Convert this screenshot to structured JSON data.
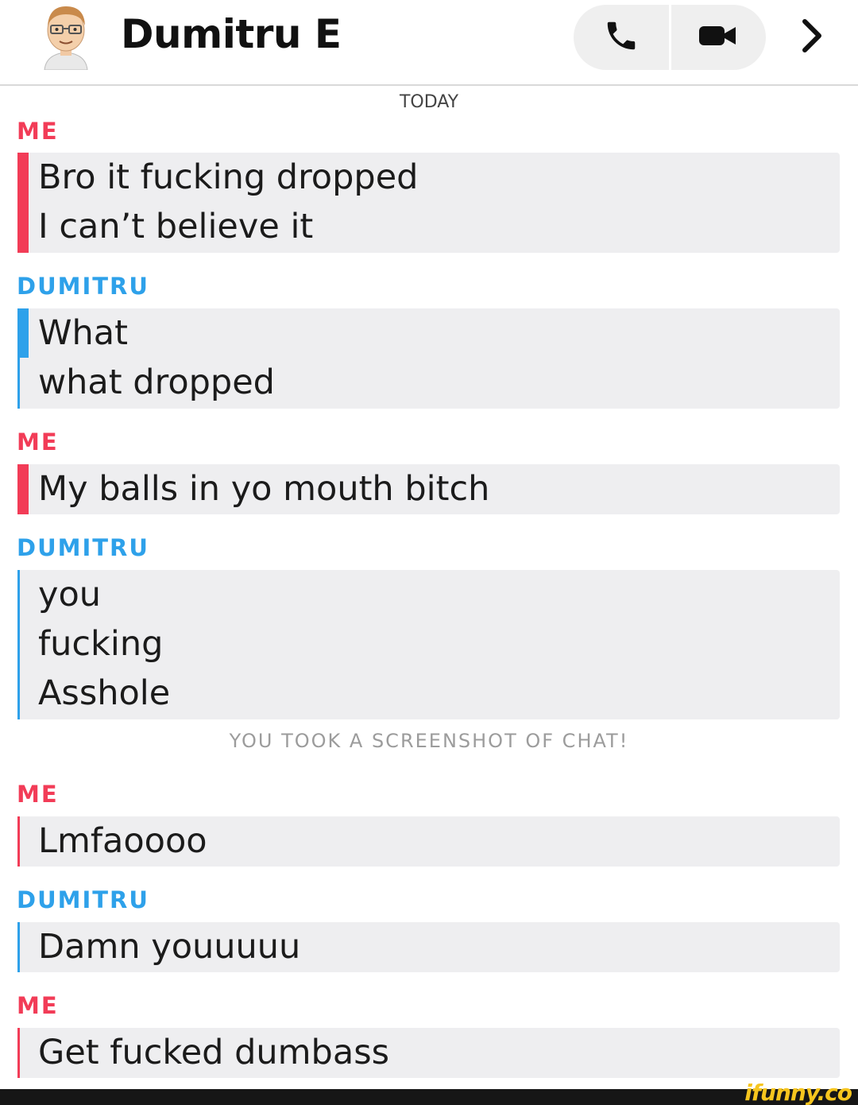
{
  "header": {
    "contact_name": "Dumitru E",
    "icons": {
      "avatar": "bitmoji-avatar-icon",
      "call": "phone-icon",
      "video": "video-camera-icon",
      "more": "chevron-right-icon"
    }
  },
  "chat": {
    "day_label": "TODAY",
    "screenshot_notice": "YOU TOOK A SCREENSHOT OF CHAT!",
    "groups": [
      {
        "sender": "ME",
        "lines": [
          "Bro it fucking dropped",
          "I can’t believe it"
        ]
      },
      {
        "sender": "DUMITRU",
        "lines": [
          "What",
          "what dropped"
        ]
      },
      {
        "sender": "ME",
        "lines": [
          "My balls in yo mouth bitch"
        ]
      },
      {
        "sender": "DUMITRU",
        "lines": [
          "you",
          "fucking",
          "Asshole"
        ]
      },
      {
        "sender": "ME",
        "lines": [
          "Lmfaoooo"
        ]
      },
      {
        "sender": "DUMITRU",
        "lines": [
          "Damn youuuuu"
        ]
      },
      {
        "sender": "ME",
        "lines": [
          "Get fucked dumbass"
        ]
      }
    ]
  },
  "colors": {
    "me": "#f23c57",
    "them": "#2ea1ea",
    "bubble_bg": "#eeeef0"
  },
  "watermark": "ifunny.co"
}
